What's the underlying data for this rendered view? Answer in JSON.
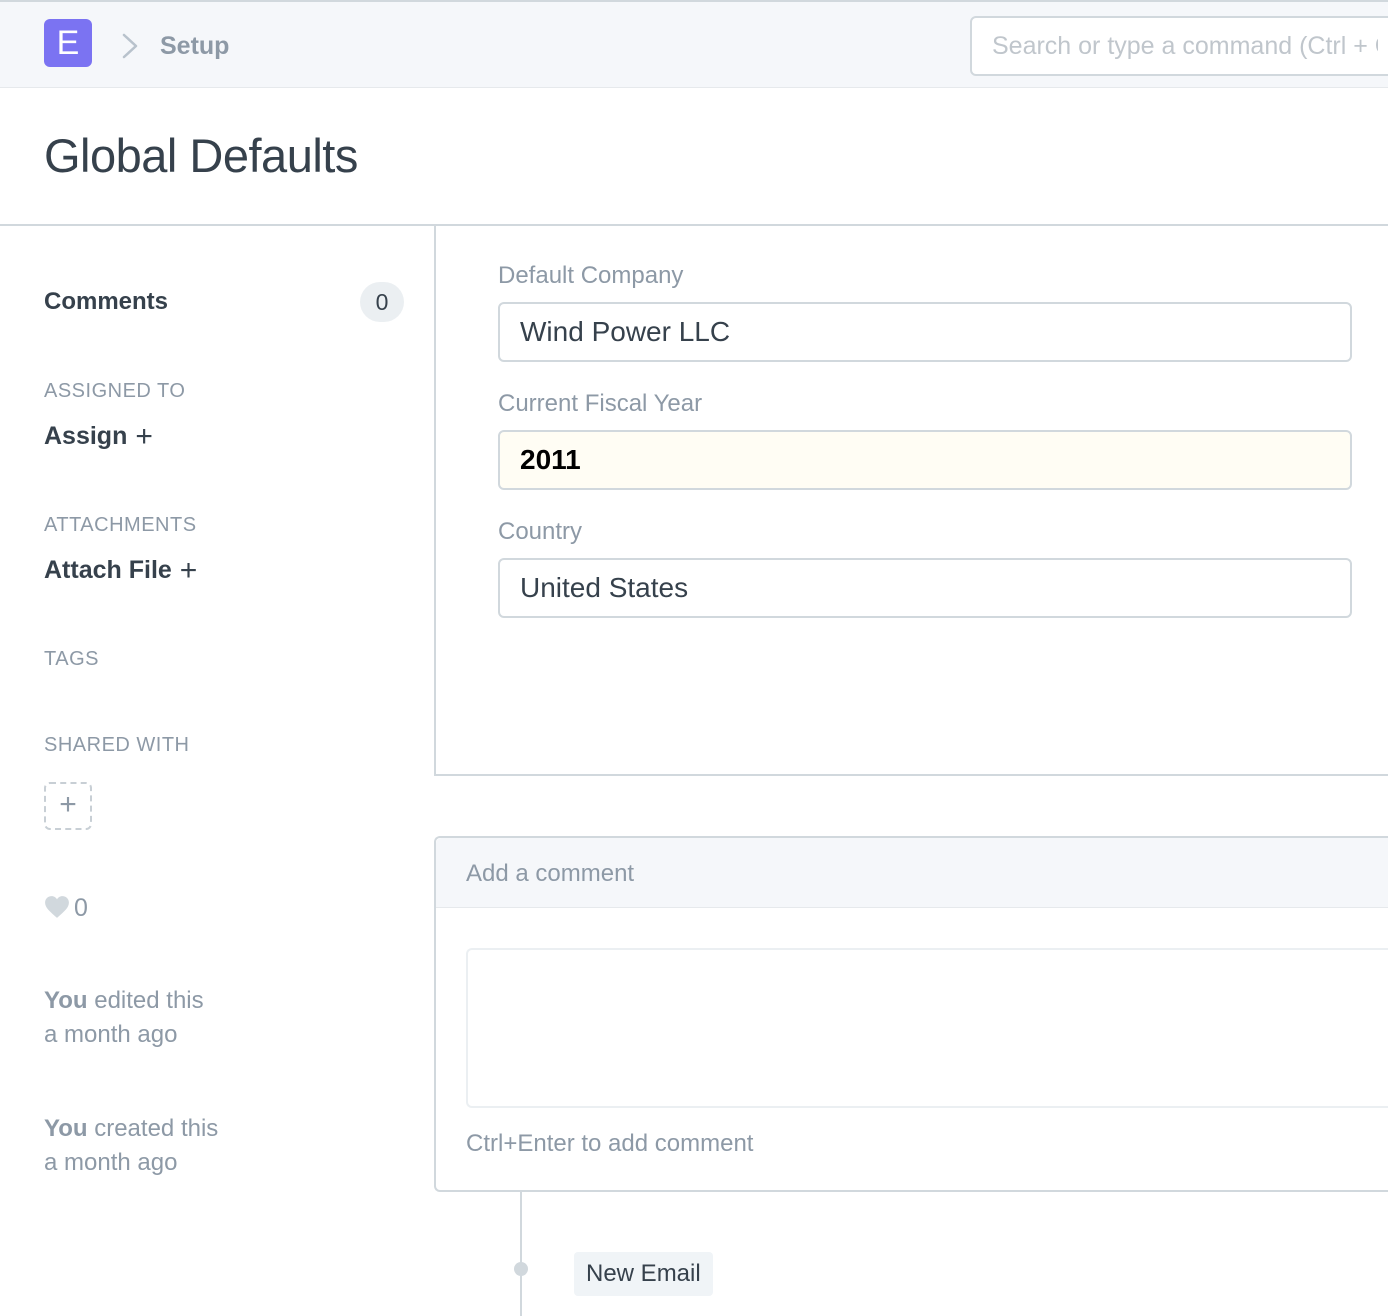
{
  "navbar": {
    "logo_letter": "E",
    "breadcrumb": "Setup",
    "search_placeholder": "Search or type a command (Ctrl + G)"
  },
  "page": {
    "title": "Global Defaults"
  },
  "sidebar": {
    "comments_label": "Comments",
    "comments_count": "0",
    "assigned_to_label": "ASSIGNED TO",
    "assign_action": "Assign",
    "attachments_label": "ATTACHMENTS",
    "attach_action": "Attach File",
    "tags_label": "TAGS",
    "shared_with_label": "SHARED WITH",
    "share_add_symbol": "+",
    "plus_symbol": "+",
    "like_count": "0",
    "activity": [
      {
        "who": "You",
        "what": "edited this",
        "when": "a month ago"
      },
      {
        "who": "You",
        "what": "created this",
        "when": "a month ago"
      }
    ]
  },
  "form": {
    "fields": [
      {
        "label": "Default Company",
        "value": "Wind Power LLC"
      },
      {
        "label": "Current Fiscal Year",
        "value": "2011"
      },
      {
        "label": "Country",
        "value": "United States"
      }
    ]
  },
  "comment_box": {
    "header": "Add a comment",
    "hint": "Ctrl+Enter to add comment"
  },
  "timeline": {
    "new_email_label": "New Email"
  },
  "colors": {
    "logo_bg": "#7b73f2",
    "text_primary": "#36414c",
    "text_muted": "#8d99a6",
    "border": "#d1d8dd",
    "navbar_bg": "#f5f7fa",
    "highlight_input_bg": "#fffdf4"
  }
}
